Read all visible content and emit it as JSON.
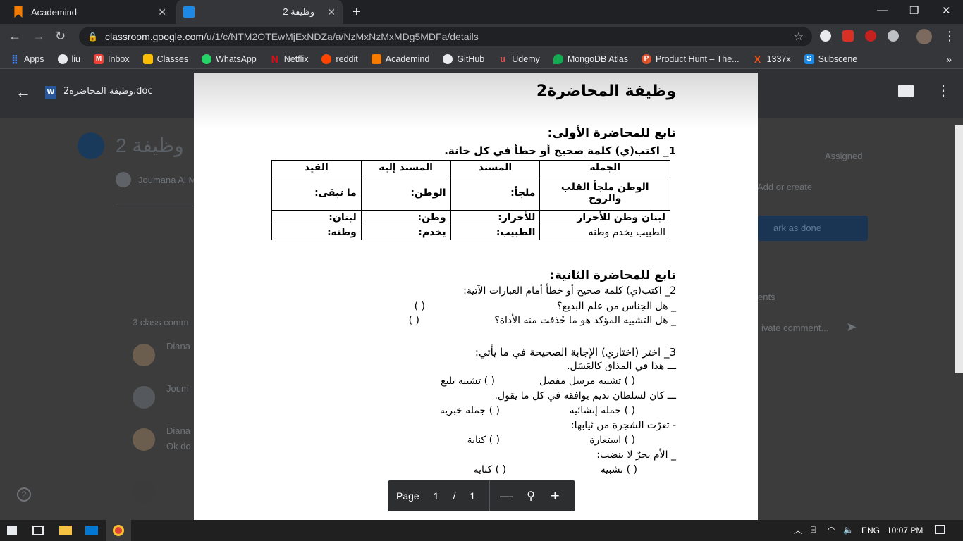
{
  "tabs": [
    {
      "title": "Academind"
    },
    {
      "title": "وظيفة 2"
    }
  ],
  "address": {
    "url_host": "classroom.google.com",
    "url_path": "/u/1/c/NTM2OTEwMjExNDZa/a/NzMxNzMxMDg5MDFa/details"
  },
  "bookmarks": [
    "Apps",
    "liu",
    "Inbox",
    "Classes",
    "WhatsApp",
    "Netflix",
    "reddit",
    "Academind",
    "GitHub",
    "Udemy",
    "MongoDB Atlas",
    "Product Hunt – The...",
    "1337x",
    "Subscene"
  ],
  "viewer": {
    "file_name": "وظيفة المحاضرة2.doc",
    "file_type_letter": "W"
  },
  "background": {
    "assignment_title": "وظيفة 2",
    "author": "Joumana Al M",
    "class_comments": "3 class comm",
    "assigned": "Assigned",
    "add_or_create": "Add or create",
    "mark_done": "ark as done",
    "comments_head": "ents",
    "private_comment": "ivate comment...",
    "c1": "Diana",
    "c2": "Joum",
    "c3": "Diana",
    "c3b": "Ok do"
  },
  "doc": {
    "title": "وظيفة المحاضرة2",
    "section1": "تابع للمحاضرة الأولى:",
    "q1": "1_ اكتب(ي) كلمة صحيح أو خطأ في كل خانة.",
    "table_headers": [
      "الجملة",
      "المسند",
      "المسند إليه",
      "القيد"
    ],
    "table_rows": [
      [
        "الوطن ملجأ القلب والروح",
        "ملجأ:",
        "الوطن:",
        "ما تبقى:"
      ],
      [
        "لبنان وطن للأحرار",
        "للأحرار:",
        "وطن:",
        "لبنان:"
      ],
      [
        "الطبيب يخدم وطنه",
        "الطبيب:",
        "يخدم:",
        "وطنه:"
      ]
    ],
    "section2": "تابع للمحاضرة الثانية:",
    "q2": "2_ اكتب(ي) كلمة صحيح أو خطأ أمام العبارات الآتية:",
    "q2a": "_ هل الجناس من علم البديع؟",
    "q2b": "_ هل التشبيه المؤكد هو ما حُذفت منه الأداة؟",
    "paren": "(        )",
    "q3": "3_ اختر (اختاري) الإجابة الصحيحة في ما يأتي:",
    "q3a": "ـــ هذا في المذاق كالعَسَل.",
    "q3a1": "(   ) تشبيه مرسل مفصل",
    "q3a2": "(   ) تشبيه بليغ",
    "q3b": "ـــ كان لسلطان نديم يوافقه في كل ما يقول.",
    "q3b1": "(   ) جملة إنشائية",
    "q3b2": "(   ) جملة خبرية",
    "q3c": "- تعرّت الشجرة من ثيابها:",
    "q3c1": "(   ) استعارة",
    "q3c2": "(   ) كناية",
    "q3d": "_ الأم بحرٌ لا ينضب:",
    "q3d1": "(   ) تشبيه",
    "q3d2": "(   ) كناية"
  },
  "pager": {
    "label": "Page",
    "current": "1",
    "sep": "/",
    "total": "1"
  },
  "taskbar": {
    "lang": "ENG",
    "time": "10:07 PM"
  }
}
